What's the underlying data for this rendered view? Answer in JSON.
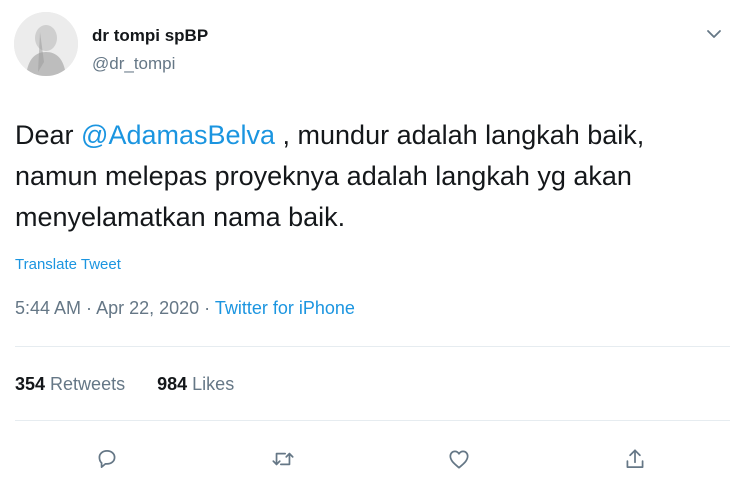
{
  "user": {
    "display_name": "dr tompi spBP",
    "handle": "@dr_tompi"
  },
  "tweet": {
    "text_before_mention": "Dear ",
    "mention": "@AdamasBelva",
    "text_after_mention": " , mundur adalah langkah baik, namun melepas proyeknya adalah langkah yg akan menyelamatkan nama baik.",
    "translate_label": "Translate Tweet",
    "time": "5:44 AM",
    "separator": " · ",
    "date": "Apr 22, 2020",
    "source": "Twitter for iPhone"
  },
  "stats": {
    "retweets_count": "354",
    "retweets_label": " Retweets",
    "likes_count": "984",
    "likes_label": " Likes"
  },
  "icons": {
    "menu": "chevron-down-icon",
    "reply": "reply-icon",
    "retweet": "retweet-icon",
    "like": "heart-icon",
    "share": "share-icon"
  },
  "colors": {
    "link": "#1b95e0",
    "secondary_text": "#657786",
    "primary_text": "#14171a",
    "divider": "#e6ecf0"
  }
}
